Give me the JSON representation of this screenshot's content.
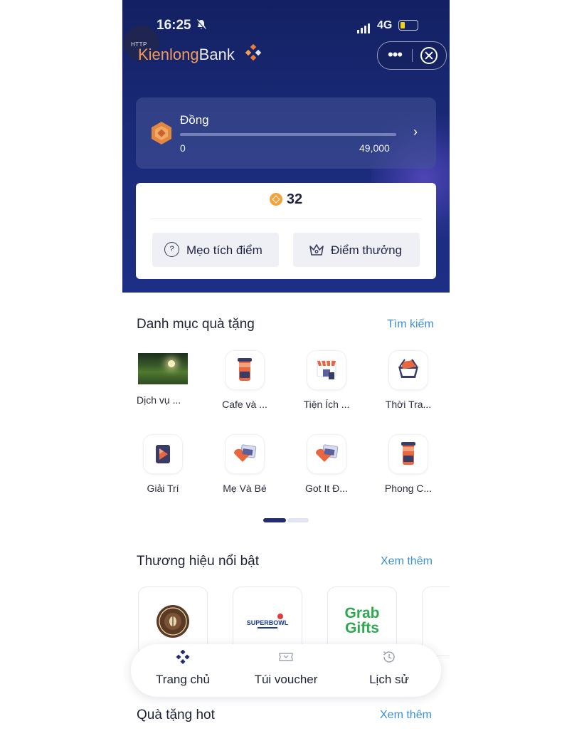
{
  "status_bar": {
    "time": "16:25",
    "network": "4G"
  },
  "header": {
    "http_badge": "HTTP",
    "logo_part1": "Kienlong",
    "logo_part2": "Bank",
    "more_label": "•••"
  },
  "tier": {
    "name": "Đồng",
    "progress_min": "0",
    "progress_max": "49,000",
    "progress_fraction": 0.0
  },
  "points": {
    "value": "32",
    "tips_button": "Mẹo tích điểm",
    "bonus_button": "Điểm thưởng"
  },
  "categories": {
    "title": "Danh mục quà tặng",
    "search_link": "Tìm kiếm",
    "items": [
      {
        "label": "Dịch vụ ...",
        "icon": "landscape-photo"
      },
      {
        "label": "Cafe và ...",
        "icon": "coffee-cup-icon"
      },
      {
        "label": "Tiện Ích ...",
        "icon": "shop-icon"
      },
      {
        "label": "Thời Tra...",
        "icon": "shopping-basket-icon"
      },
      {
        "label": "Giải Trí",
        "icon": "play-icon"
      },
      {
        "label": "Mẹ Và Bé",
        "icon": "gift-card-icon"
      },
      {
        "label": "Got It Đ...",
        "icon": "gift-card-icon"
      },
      {
        "label": "Phong C...",
        "icon": "coffee-cup-icon"
      }
    ],
    "page_indicator": {
      "current": 1,
      "total": 2
    }
  },
  "brands": {
    "title": "Thương hiệu nổi bật",
    "more_link": "Xem thêm",
    "items": [
      {
        "name": "The Coffee Bean",
        "logo_text": ""
      },
      {
        "name": "Superbowl",
        "logo_text": "SUPERBOWL"
      },
      {
        "name": "Grab Gifts",
        "logo_line1": "Grab",
        "logo_line2": "Gifts"
      }
    ]
  },
  "next_section": {
    "title": "Quà tặng hot",
    "more_link": "Xem thêm"
  },
  "tabbar": {
    "home": "Trang chủ",
    "voucher": "Túi voucher",
    "history": "Lịch sử"
  },
  "colors": {
    "hero_bg": "#1a2a78",
    "accent_orange": "#f59a3a",
    "link_blue": "#3b8fd9",
    "brand_navy": "#232c6e",
    "grab_green": "#2fa84f"
  }
}
